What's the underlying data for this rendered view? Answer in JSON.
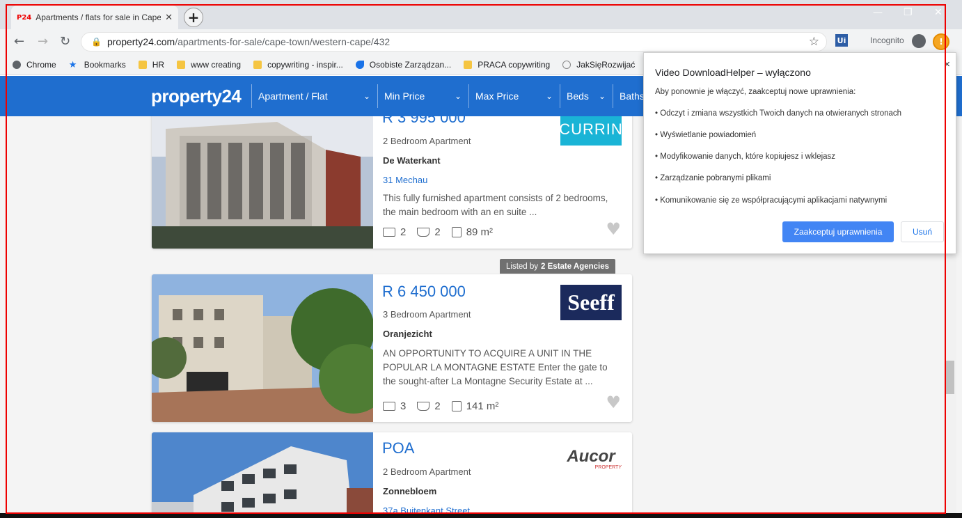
{
  "browser": {
    "tab_title": "Apartments / flats for sale in Cape",
    "tab_favicon": "P24",
    "url_domain": "property24.com",
    "url_path": "/apartments-for-sale/cape-town/western-cape/432",
    "incognito_label": "Incognito",
    "extension_label": "Ui",
    "bookmarks": [
      {
        "label": "Chrome",
        "icon": "chrome-icon"
      },
      {
        "label": "Bookmarks",
        "icon": "star-icon"
      },
      {
        "label": "HR",
        "icon": "folder-icon"
      },
      {
        "label": "www creating",
        "icon": "folder-icon"
      },
      {
        "label": "copywriting - inspir...",
        "icon": "folder-icon"
      },
      {
        "label": "Osobiste Zarządzan...",
        "icon": "drop-icon"
      },
      {
        "label": "PRACA copywriting",
        "icon": "folder-icon"
      },
      {
        "label": "JakSięRozwijać",
        "icon": "bulb-icon"
      }
    ]
  },
  "site": {
    "logo": "property24",
    "filters": [
      "Apartment / Flat",
      "Min Price",
      "Max Price",
      "Beds",
      "Baths"
    ]
  },
  "listings": [
    {
      "price": "R 3 995 000",
      "type": "2 Bedroom Apartment",
      "suburb": "De Waterkant",
      "street": "31 Mechau",
      "description": "This fully furnished apartment consists of 2 bedrooms, the main bedroom with an en suite ...",
      "beds": "2",
      "baths": "2",
      "size": "89 m²",
      "agency": "CURRIN"
    },
    {
      "price": "R 6 450 000",
      "type": "3 Bedroom Apartment",
      "suburb": "Oranjezicht",
      "street": "",
      "description": "AN OPPORTUNITY TO ACQUIRE A UNIT IN THE POPULAR LA MONTAGNE ESTATE Enter the gate to the sought-after La Montagne Security Estate at ...",
      "beds": "3",
      "baths": "2",
      "size": "141 m²",
      "agency": "Seeff",
      "listed_by_prefix": "Listed by",
      "listed_by_agencies": "2 Estate Agencies"
    },
    {
      "price": "POA",
      "type": "2 Bedroom Apartment",
      "suburb": "Zonnebloem",
      "street": "37a Buitenkant Street",
      "agency": "Aucor",
      "agency_sub": "PROPERTY"
    }
  ],
  "popup": {
    "title": "Video DownloadHelper – wyłączono",
    "intro": "Aby ponownie je włączyć, zaakceptuj nowe uprawnienia:",
    "permissions": [
      "• Odczyt i zmiana wszystkich Twoich danych na otwieranych stronach",
      "• Wyświetlanie powiadomień",
      "• Modyfikowanie danych, które kopiujesz i wklejasz",
      "• Zarządzanie pobranymi plikami",
      "• Komunikowanie się ze współpracującymi aplikacjami natywnymi"
    ],
    "accept_label": "Zaakceptuj uprawnienia",
    "remove_label": "Usuń",
    "close_glyph": "×"
  },
  "colors": {
    "brand_blue": "#1f6ecf",
    "accept_blue": "#4285f4",
    "seeff_navy": "#1b2a5c",
    "currin_cyan": "#1ab4d6"
  }
}
